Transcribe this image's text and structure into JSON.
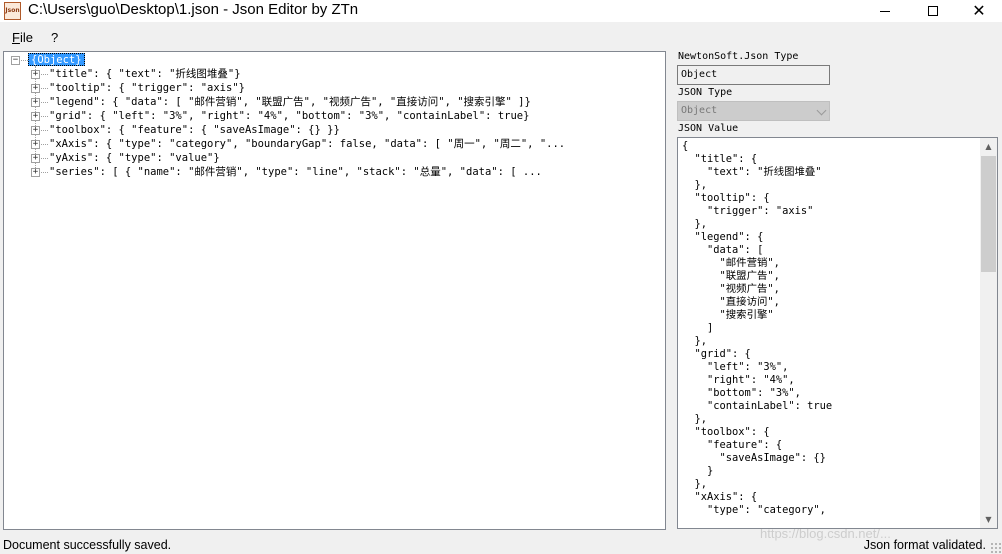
{
  "window": {
    "title": "C:\\Users\\guo\\Desktop\\1.json - Json Editor by ZTn",
    "icon_text": "Json",
    "close_glyph": "✕"
  },
  "menu": {
    "file": "File",
    "help": "?"
  },
  "tree": {
    "root": "{Object}",
    "nodes": [
      "\"title\": {  \"text\": \"折线图堆叠\"}",
      "\"tooltip\": {  \"trigger\": \"axis\"}",
      "\"legend\": {  \"data\": [   \"邮件营销\",   \"联盟广告\",   \"视频广告\",   \"直接访问\",   \"搜索引擎\"  ]}",
      "\"grid\": {  \"left\": \"3%\",  \"right\": \"4%\",  \"bottom\": \"3%\",  \"containLabel\": true}",
      "\"toolbox\": {  \"feature\": {    \"saveAsImage\": {}  }}",
      "\"xAxis\": {  \"type\": \"category\",  \"boundaryGap\": false,  \"data\": [   \"周一\",   \"周二\",   \"...",
      "\"yAxis\": {  \"type\": \"value\"}",
      "\"series\": [  {   \"name\": \"邮件营销\",   \"type\": \"line\",   \"stack\": \"总量\",   \"data\": [     ..."
    ]
  },
  "side": {
    "newtonsoft_label": "NewtonSoft.Json Type",
    "newtonsoft_value": "Object",
    "json_type_label": "JSON Type",
    "json_type_value": "Object",
    "json_value_label": "JSON Value",
    "json_value_text": "{\n  \"title\": {\n    \"text\": \"折线图堆叠\"\n  },\n  \"tooltip\": {\n    \"trigger\": \"axis\"\n  },\n  \"legend\": {\n    \"data\": [\n      \"邮件营销\",\n      \"联盟广告\",\n      \"视频广告\",\n      \"直接访问\",\n      \"搜索引擎\"\n    ]\n  },\n  \"grid\": {\n    \"left\": \"3%\",\n    \"right\": \"4%\",\n    \"bottom\": \"3%\",\n    \"containLabel\": true\n  },\n  \"toolbox\": {\n    \"feature\": {\n      \"saveAsImage\": {}\n    }\n  },\n  \"xAxis\": {\n    \"type\": \"category\","
  },
  "status": {
    "left": "Document successfully saved.",
    "right": "Json format validated."
  },
  "watermark": "https://blog.csdn.net/..."
}
